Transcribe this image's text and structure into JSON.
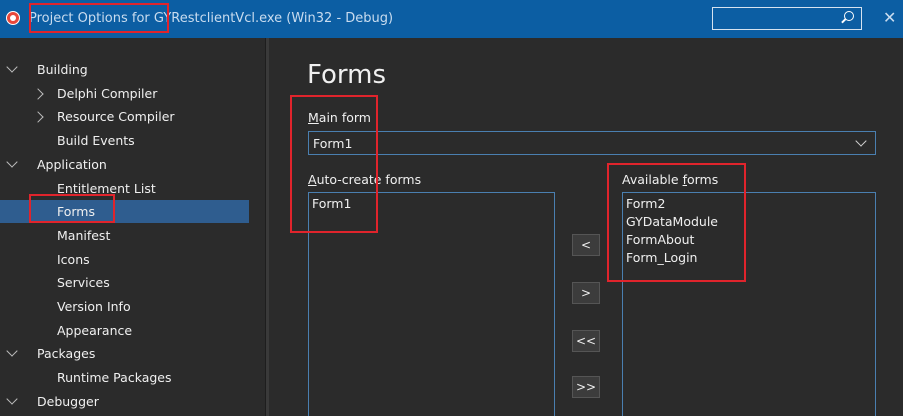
{
  "titlebar": {
    "prefix": "Project Options for ",
    "rest": "GYRestclientVcl.exe  (Win32 - Debug)",
    "close_label": "✕"
  },
  "sidebar": {
    "items": [
      {
        "label": "Building",
        "level": 0,
        "expander": "down"
      },
      {
        "label": "Delphi Compiler",
        "level": 1,
        "expander": "right"
      },
      {
        "label": "Resource Compiler",
        "level": 1,
        "expander": "right"
      },
      {
        "label": "Build Events",
        "level": 1,
        "expander": null
      },
      {
        "label": "Application",
        "level": 0,
        "expander": "down"
      },
      {
        "label": "Entitlement List",
        "level": 1,
        "expander": null
      },
      {
        "label": "Forms",
        "level": 1,
        "expander": null,
        "selected": true
      },
      {
        "label": "Manifest",
        "level": 1,
        "expander": null
      },
      {
        "label": "Icons",
        "level": 1,
        "expander": null
      },
      {
        "label": "Services",
        "level": 1,
        "expander": null
      },
      {
        "label": "Version Info",
        "level": 1,
        "expander": null
      },
      {
        "label": "Appearance",
        "level": 1,
        "expander": null
      },
      {
        "label": "Packages",
        "level": 0,
        "expander": "down"
      },
      {
        "label": "Runtime Packages",
        "level": 1,
        "expander": null
      },
      {
        "label": "Debugger",
        "level": 0,
        "expander": "down"
      }
    ]
  },
  "main": {
    "title": "Forms",
    "main_form_label_mnemonic": "M",
    "main_form_label_rest": "ain form",
    "main_form_value": "Form1",
    "auto_create_label_mnemonic": "A",
    "auto_create_label_rest": "uto-create forms",
    "auto_create_items": [
      "Form1"
    ],
    "available_label_prefix": "Available ",
    "available_label_mnemonic": "f",
    "available_label_rest": "orms",
    "available_items": [
      "Form2",
      "GYDataModule",
      "FormAbout",
      "Form_Login"
    ],
    "buttons": {
      "move_left": "<",
      "move_right": ">",
      "move_all_left": "<<",
      "move_all_right": ">>"
    }
  },
  "colors": {
    "titlebar": "#0c5ea3",
    "selection": "#2f5d8f",
    "highlight_box": "#e0242c"
  }
}
